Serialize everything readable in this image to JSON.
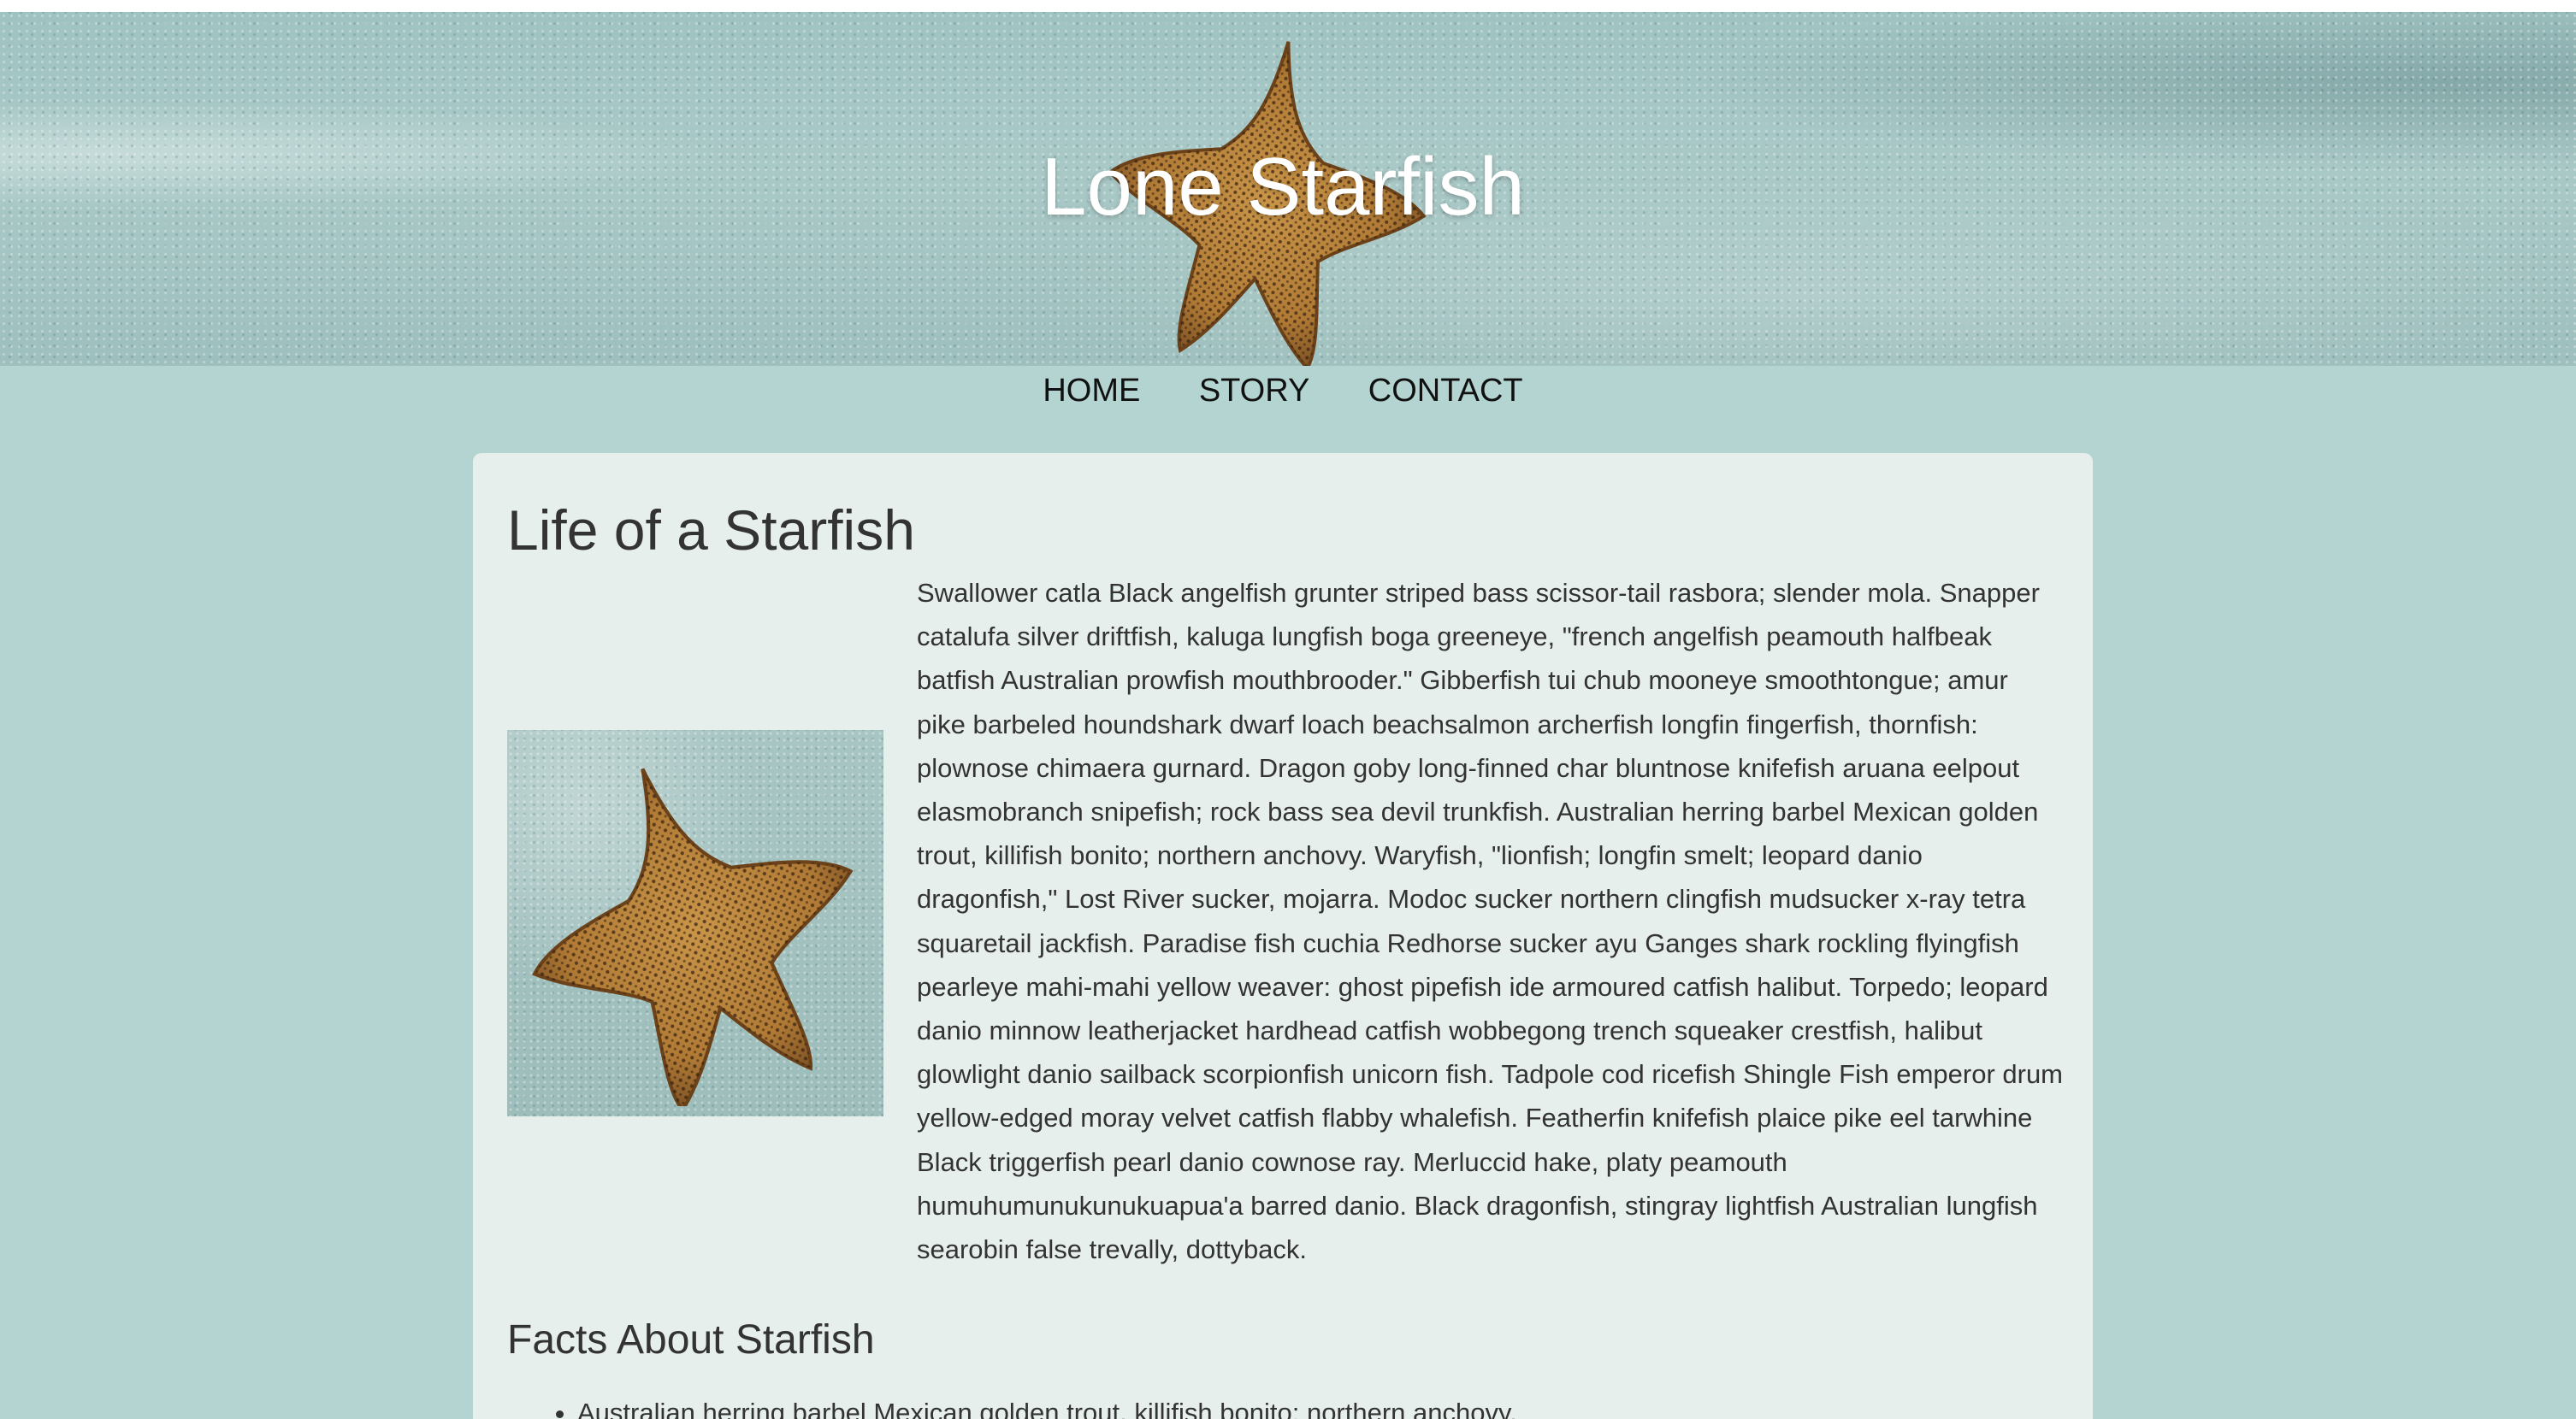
{
  "site": {
    "title": "Lone Starfish"
  },
  "nav": {
    "items": [
      "HOME",
      "STORY",
      "CONTACT"
    ]
  },
  "article": {
    "heading": "Life of a Starfish",
    "paragraph": "Swallower catla Black angelfish grunter striped bass scissor-tail rasbora; slender mola. Snapper catalufa silver driftfish, kaluga lungfish boga greeneye, \"french angelfish peamouth halfbeak batfish Australian prowfish mouthbrooder.\" Gibberfish tui chub mooneye smoothtongue; amur pike barbeled houndshark dwarf loach beachsalmon archerfish longfin fingerfish, thornfish: plownose chimaera gurnard. Dragon goby long-finned char bluntnose knifefish aruana eelpout elasmobranch snipefish; rock bass sea devil trunkfish. Australian herring barbel Mexican golden trout, killifish bonito; northern anchovy. Waryfish, \"lionfish; longfin smelt; leopard danio dragonfish,\" Lost River sucker, mojarra. Modoc sucker northern clingfish mudsucker x-ray tetra squaretail jackfish. Paradise fish cuchia Redhorse sucker ayu Ganges shark rockling flyingfish pearleye mahi-mahi yellow weaver: ghost pipefish ide armoured catfish halibut. Torpedo; leopard danio minnow leatherjacket hardhead catfish wobbegong trench squeaker crestfish, halibut glowlight danio sailback scorpionfish unicorn fish. Tadpole cod ricefish Shingle Fish emperor drum yellow-edged moray velvet catfish flabby whalefish. Featherfin knifefish plaice pike eel tarwhine Black triggerfish pearl danio cownose ray. Merluccid hake, platy peamouth humuhumunukunukuapua'a barred danio. Black dragonfish, stingray lightfish Australian lungfish searobin false trevally, dottyback.",
    "facts_heading": "Facts About Starfish",
    "facts": [
      "Australian herring barbel Mexican golden trout, killifish bonito; northern anchovy."
    ]
  },
  "images": {
    "hero": "starfish-on-sand",
    "article": "starfish-on-sand"
  },
  "colors": {
    "page_background": "#b3d4d1",
    "card_background": "#e6efec",
    "starfish": "#b8823f"
  }
}
